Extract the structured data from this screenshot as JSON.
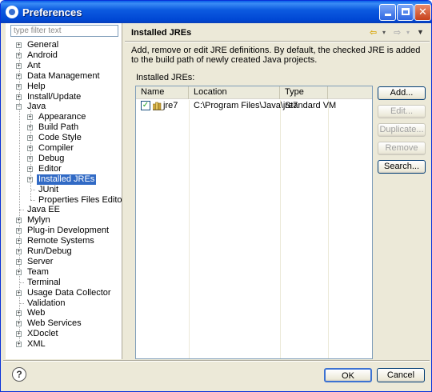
{
  "window": {
    "title": "Preferences"
  },
  "filter": {
    "placeholder": "type filter text"
  },
  "tree": [
    {
      "label": "General",
      "level": 0,
      "expander": "+"
    },
    {
      "label": "Android",
      "level": 0,
      "expander": "+"
    },
    {
      "label": "Ant",
      "level": 0,
      "expander": "+"
    },
    {
      "label": "Data Management",
      "level": 0,
      "expander": "+"
    },
    {
      "label": "Help",
      "level": 0,
      "expander": "+"
    },
    {
      "label": "Install/Update",
      "level": 0,
      "expander": "+"
    },
    {
      "label": "Java",
      "level": 0,
      "expander": "-"
    },
    {
      "label": "Appearance",
      "level": 1,
      "expander": "+"
    },
    {
      "label": "Build Path",
      "level": 1,
      "expander": "+"
    },
    {
      "label": "Code Style",
      "level": 1,
      "expander": "+"
    },
    {
      "label": "Compiler",
      "level": 1,
      "expander": "+"
    },
    {
      "label": "Debug",
      "level": 1,
      "expander": "+"
    },
    {
      "label": "Editor",
      "level": 1,
      "expander": "+"
    },
    {
      "label": "Installed JREs",
      "level": 1,
      "expander": "+",
      "selected": true
    },
    {
      "label": "JUnit",
      "level": 1,
      "expander": ""
    },
    {
      "label": "Properties Files Editor",
      "level": 1,
      "expander": ""
    },
    {
      "label": "Java EE",
      "level": 0,
      "expander": ""
    },
    {
      "label": "Mylyn",
      "level": 0,
      "expander": "+"
    },
    {
      "label": "Plug-in Development",
      "level": 0,
      "expander": "+"
    },
    {
      "label": "Remote Systems",
      "level": 0,
      "expander": "+"
    },
    {
      "label": "Run/Debug",
      "level": 0,
      "expander": "+"
    },
    {
      "label": "Server",
      "level": 0,
      "expander": "+"
    },
    {
      "label": "Team",
      "level": 0,
      "expander": "+"
    },
    {
      "label": "Terminal",
      "level": 0,
      "expander": ""
    },
    {
      "label": "Usage Data Collector",
      "level": 0,
      "expander": "+"
    },
    {
      "label": "Validation",
      "level": 0,
      "expander": ""
    },
    {
      "label": "Web",
      "level": 0,
      "expander": "+"
    },
    {
      "label": "Web Services",
      "level": 0,
      "expander": "+"
    },
    {
      "label": "XDoclet",
      "level": 0,
      "expander": "+"
    },
    {
      "label": "XML",
      "level": 0,
      "expander": "+"
    }
  ],
  "page": {
    "title": "Installed JREs",
    "description": "Add, remove or edit JRE definitions. By default, the checked JRE is added to the build path of newly created Java projects.",
    "installed_label": "Installed JREs:",
    "columns": [
      "Name",
      "Location",
      "Type"
    ],
    "rows": [
      {
        "checked": true,
        "name": "jre7",
        "location": "C:\\Program Files\\Java\\jre7",
        "type": "Standard VM"
      }
    ],
    "buttons": {
      "add": "Add...",
      "edit": "Edit...",
      "duplicate": "Duplicate...",
      "remove": "Remove",
      "search": "Search..."
    }
  },
  "dialog_buttons": {
    "ok": "OK",
    "cancel": "Cancel"
  },
  "colors": {
    "selection": "#316ac5",
    "titlebar": "#0a5fe8",
    "dialog_bg": "#ece9d8"
  }
}
